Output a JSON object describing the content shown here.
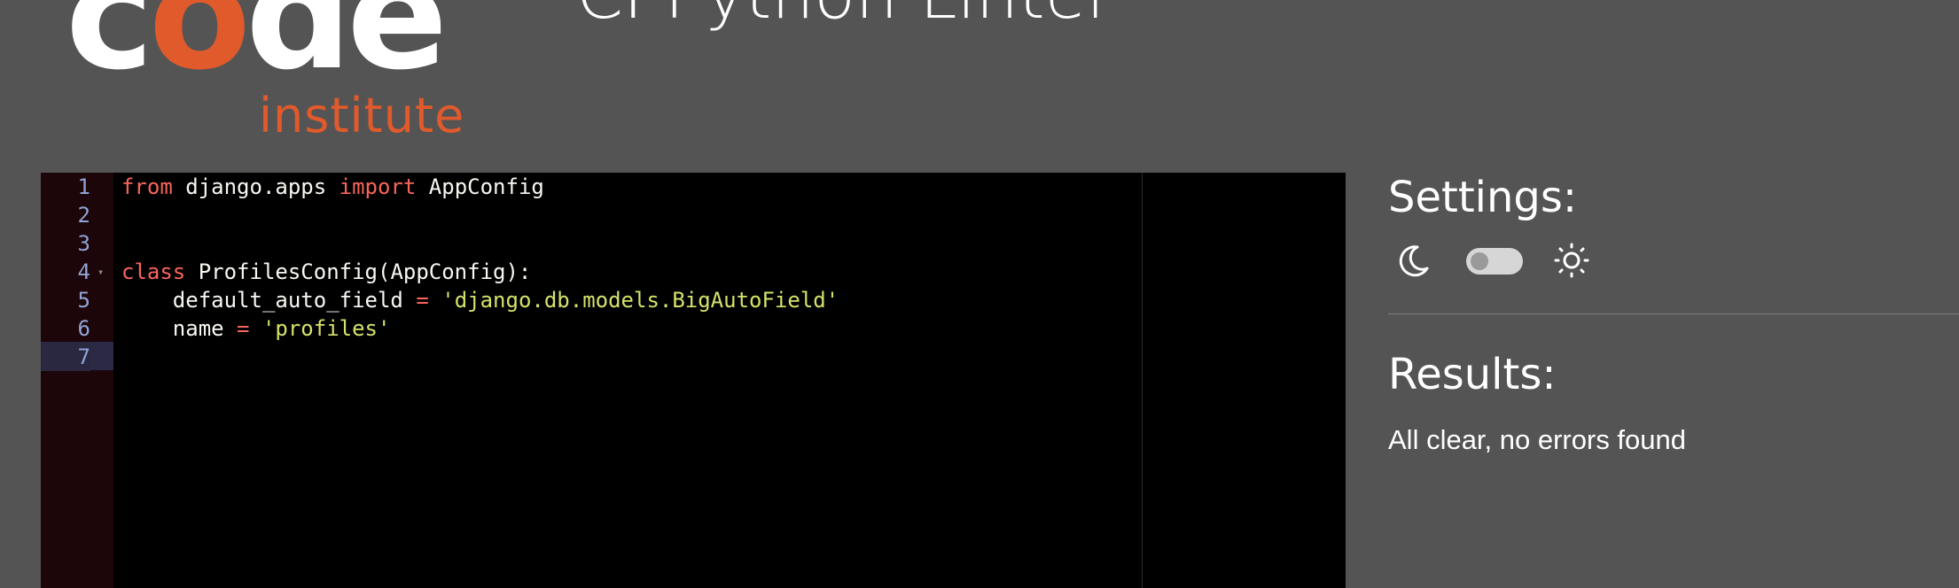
{
  "header": {
    "logo_word_1": "c",
    "logo_word_accent": "o",
    "logo_word_2": "de",
    "logo_sub": "institute",
    "title": "CI Python Linter"
  },
  "editor": {
    "line_numbers": [
      "1",
      "2",
      "3",
      "4",
      "5",
      "6",
      "7"
    ],
    "active_line": 7,
    "lines": [
      [
        {
          "t": "from",
          "c": "kw"
        },
        {
          "t": " django.apps ",
          "c": ""
        },
        {
          "t": "import",
          "c": "kw"
        },
        {
          "t": " AppConfig",
          "c": ""
        }
      ],
      [],
      [],
      [
        {
          "t": "class",
          "c": "kw"
        },
        {
          "t": " ProfilesConfig(AppConfig):",
          "c": ""
        }
      ],
      [
        {
          "t": "    default_auto_field ",
          "c": ""
        },
        {
          "t": "=",
          "c": "op"
        },
        {
          "t": " ",
          "c": ""
        },
        {
          "t": "'django.db.models.BigAutoField'",
          "c": "str"
        }
      ],
      [
        {
          "t": "    name ",
          "c": ""
        },
        {
          "t": "=",
          "c": "op"
        },
        {
          "t": " ",
          "c": ""
        },
        {
          "t": "'profiles'",
          "c": "str"
        }
      ],
      []
    ]
  },
  "settings": {
    "title": "Settings:",
    "theme_toggle_state": "dark",
    "icons": [
      "moon-icon",
      "sun-icon"
    ]
  },
  "results": {
    "title": "Results:",
    "message": "All clear, no errors found"
  },
  "colors": {
    "background": "#545454",
    "editor_bg": "#000000",
    "gutter_bg": "#1d060a",
    "brand_orange": "#e05a2b",
    "keyword": "#f8655c",
    "string": "#d6e26a"
  }
}
